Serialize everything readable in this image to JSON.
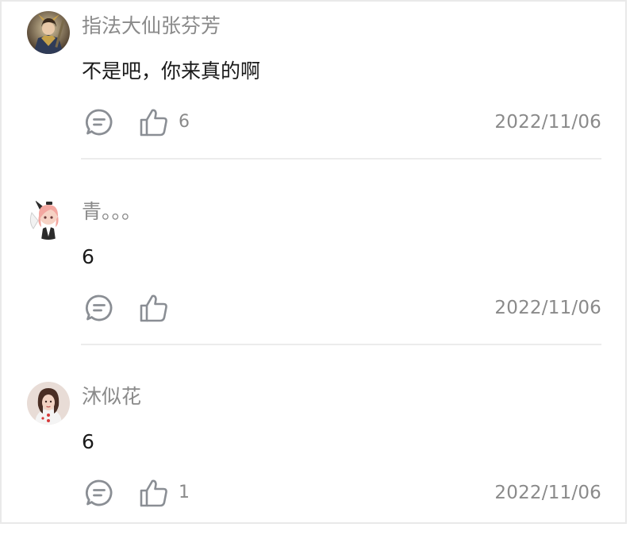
{
  "comments": [
    {
      "username": "指法大仙张芬芳",
      "text": "不是吧，你来真的啊",
      "likes": "6",
      "date": "2022/11/06",
      "avatar_icon": "warrior-avatar"
    },
    {
      "username": "青。。。",
      "text": "6",
      "likes": "",
      "date": "2022/11/06",
      "avatar_icon": "anime-girl-avatar"
    },
    {
      "username": "沐似花",
      "text": "6",
      "likes": "1",
      "date": "2022/11/06",
      "avatar_icon": "woman-portrait-avatar"
    }
  ],
  "icons": {
    "reply": "comment-bubble-icon",
    "like": "thumbs-up-icon"
  },
  "colors": {
    "username": "#8a8a8a",
    "text": "#1a1a1a",
    "icon": "#8a8e94",
    "divider": "#ececec"
  }
}
